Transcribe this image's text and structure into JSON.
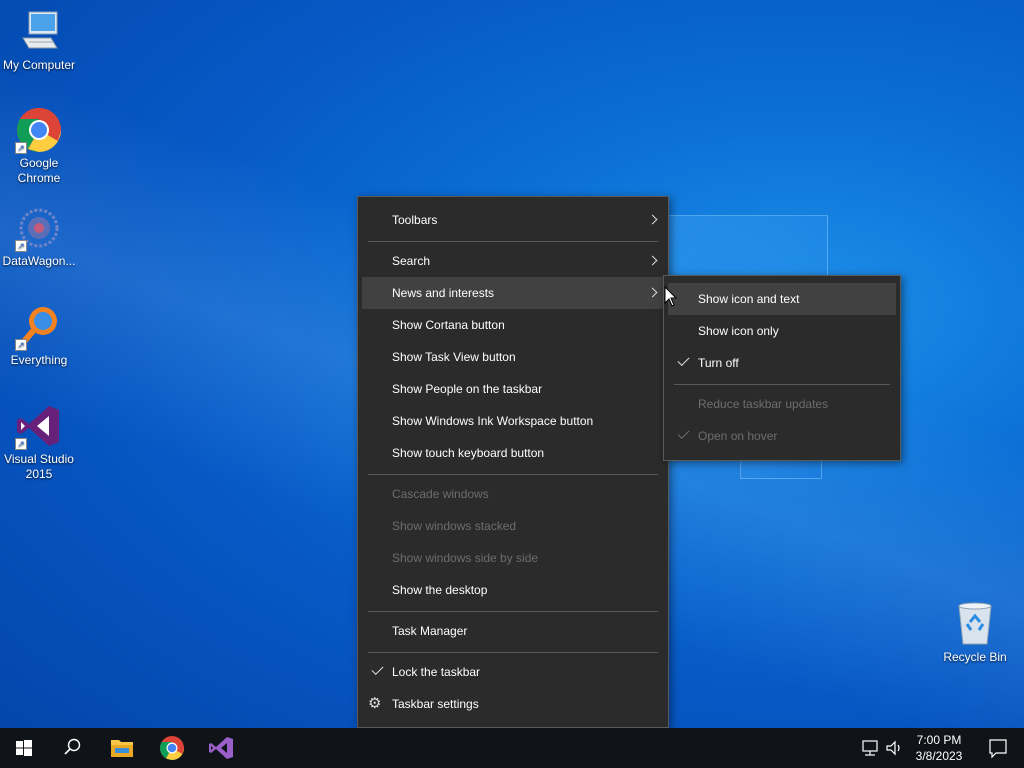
{
  "desktop": {
    "icons": [
      {
        "label": "My Computer",
        "icon": "computer-icon"
      },
      {
        "label": "Google Chrome",
        "icon": "chrome-icon"
      },
      {
        "label": "DataWagon...",
        "icon": "datawagon-icon"
      },
      {
        "label": "Everything",
        "icon": "everything-search-icon"
      },
      {
        "label": "Visual Studio 2015",
        "icon": "visual-studio-icon"
      },
      {
        "label": "Recycle Bin",
        "icon": "recycle-bin-icon"
      }
    ]
  },
  "context_menu": {
    "items": [
      {
        "label": "Toolbars",
        "submenu": true
      },
      {
        "label": "Search",
        "submenu": true
      },
      {
        "label": "News and interests",
        "submenu": true,
        "highlighted": true
      },
      {
        "label": "Show Cortana button"
      },
      {
        "label": "Show Task View button"
      },
      {
        "label": "Show People on the taskbar"
      },
      {
        "label": "Show Windows Ink Workspace button"
      },
      {
        "label": "Show touch keyboard button"
      },
      {
        "label": "Cascade windows",
        "disabled": true
      },
      {
        "label": "Show windows stacked",
        "disabled": true
      },
      {
        "label": "Show windows side by side",
        "disabled": true
      },
      {
        "label": "Show the desktop"
      },
      {
        "label": "Task Manager"
      },
      {
        "label": "Lock the taskbar",
        "checked": true
      },
      {
        "label": "Taskbar settings",
        "icon": "gear-icon"
      }
    ]
  },
  "submenu": {
    "items": [
      {
        "label": "Show icon and text",
        "highlighted": true
      },
      {
        "label": "Show icon only"
      },
      {
        "label": "Turn off",
        "checked": true
      },
      {
        "label": "Reduce taskbar updates",
        "disabled": true
      },
      {
        "label": "Open on hover",
        "disabled": true,
        "checked": true
      }
    ]
  },
  "taskbar": {
    "pinned": [
      "start-icon",
      "search-icon",
      "file-explorer-icon",
      "chrome-icon",
      "visual-studio-icon"
    ],
    "clock": {
      "time": "7:00 PM",
      "date": "3/8/2023"
    }
  },
  "colors": {
    "menu_bg": "#2b2b2b",
    "menu_highlight": "#414141",
    "disabled_text": "#6d6d6d",
    "taskbar_bg": "#101418"
  }
}
